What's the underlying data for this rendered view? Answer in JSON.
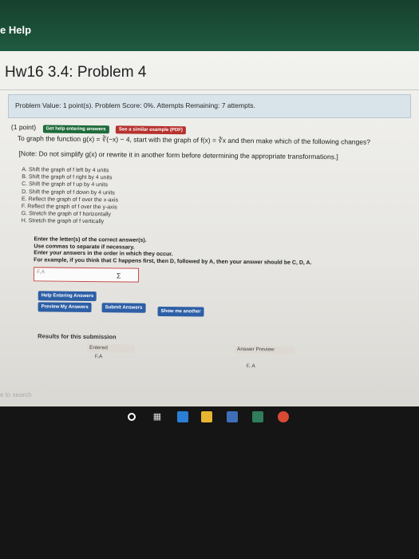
{
  "window": {
    "help_label": "e Help"
  },
  "page": {
    "title": "Hw16 3.4: Problem 4"
  },
  "info": {
    "problem_value": "Problem Value: 1 point(s). Problem Score: 0%.",
    "attempts": "Attempts Remaining: 7 attempts."
  },
  "problem": {
    "points": "(1 point)",
    "help_button": "Get help entering answers",
    "example_button": "See a similar example (PDF)",
    "question": "To graph the function g(x) = ∛(−x) − 4, start with the graph of f(x) = ∛x and then make which of the following changes?",
    "note": "[Note: Do not simplify g(x) or rewrite it in another form before determining the appropriate transformations.]",
    "options": [
      "A. Shift the graph of f left by 4 units",
      "B. Shift the graph of f right by 4 units",
      "C. Shift the graph of f up by 4 units",
      "D. Shift the graph of f down by 4 units",
      "E. Reflect the graph of f over the x-axis",
      "F. Reflect the graph of f over the y-axis",
      "G. Stretch the graph of f horizontally",
      "H. Stretch the graph of f vertically"
    ],
    "instructions": [
      "Enter the letter(s) of the correct answer(s).",
      "Use commas to separate if necessary.",
      "Enter your answers in the order in which they occur.",
      "For example, if you think that C happens first, then D, followed by A, then your answer should be C, D, A."
    ],
    "answer_value": "F,A",
    "sigma": "Σ"
  },
  "buttons": {
    "help_entering": "Help Entering Answers",
    "preview": "Preview My Answers",
    "submit": "Submit Answers",
    "show_another": "Show me another"
  },
  "results": {
    "title": "Results for this submission",
    "entered_header": "Entered",
    "preview_header": "Answer Preview",
    "entered_value": "F,A",
    "preview_value": "F, A"
  },
  "os": {
    "search_hint": "e to search"
  }
}
